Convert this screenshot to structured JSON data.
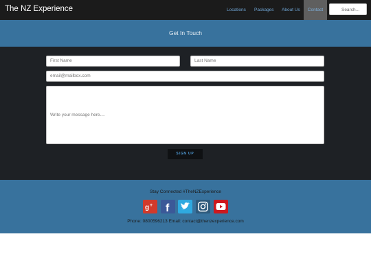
{
  "nav": {
    "brand": "The NZ Experience",
    "links": [
      "Locations",
      "Packages",
      "About Us",
      "Contact"
    ],
    "search_placeholder": "Search..."
  },
  "header": {
    "title": "Get In Touch"
  },
  "form": {
    "first_name_placeholder": "First Name",
    "last_name_placeholder": "Last Name",
    "email_placeholder": "email@mailbox.com",
    "message_placeholder": "Write your message here....",
    "submit_label": "SIGN UP"
  },
  "footer": {
    "stay_connected": "Stay Connected #TheNZExperience",
    "contact": "Phone: 0800596213 Email: contact@thenzexperience.com",
    "social_icons": [
      "google-plus-icon",
      "facebook-icon",
      "twitter-icon",
      "instagram-icon",
      "youtube-icon"
    ]
  },
  "colors": {
    "navbar": "#1b1b1b",
    "accent_blue": "#38729d",
    "form_bg": "#1e2125",
    "link": "#6fa6d6"
  }
}
